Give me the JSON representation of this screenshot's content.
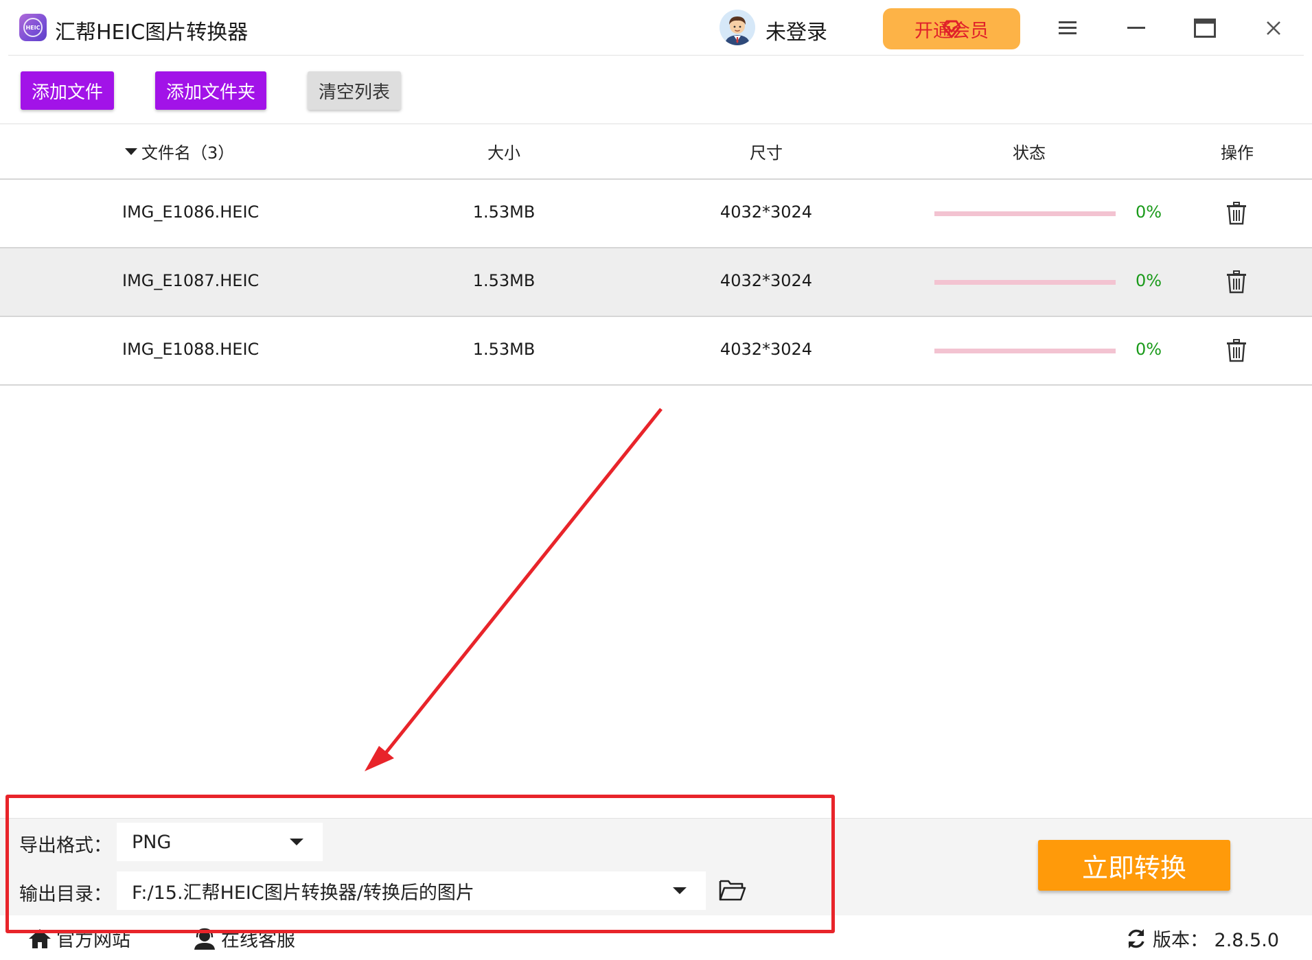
{
  "app": {
    "title": "汇帮HEIC图片转换器",
    "logo_text": "HEIC",
    "login_label": "未登录",
    "vip_label": "开通会员"
  },
  "toolbar": {
    "add_file": "添加文件",
    "add_folder": "添加文件夹",
    "clear_list": "清空列表"
  },
  "table": {
    "headers": {
      "filename": "文件名（3）",
      "size": "大小",
      "dimensions": "尺寸",
      "status": "状态",
      "action": "操作"
    },
    "rows": [
      {
        "name": "IMG_E1086.HEIC",
        "size": "1.53MB",
        "dimensions": "4032*3024",
        "progress": 0,
        "progress_text": "0%"
      },
      {
        "name": "IMG_E1087.HEIC",
        "size": "1.53MB",
        "dimensions": "4032*3024",
        "progress": 0,
        "progress_text": "0%"
      },
      {
        "name": "IMG_E1088.HEIC",
        "size": "1.53MB",
        "dimensions": "4032*3024",
        "progress": 0,
        "progress_text": "0%"
      }
    ]
  },
  "settings": {
    "format_label": "导出格式：",
    "format_value": "PNG",
    "output_label": "输出目录：",
    "output_value": "F:/15.汇帮HEIC图片转换器/转换后的图片"
  },
  "convert_button": "立即转换",
  "footer": {
    "website": "官方网站",
    "support": "在线客服",
    "version": "版本：  2.8.5.0"
  },
  "colors": {
    "primary_purple": "#a213e8",
    "convert_orange": "#ff9a0a",
    "vip_bg": "#fdb347",
    "vip_text": "#e0212a",
    "progress_track": "#f3c3d1",
    "status_green": "#1a9a1a",
    "annotation_red": "#e8242a"
  },
  "icons": [
    "app-logo-icon",
    "avatar-icon",
    "diamond-icon",
    "menu-icon",
    "minimize-icon",
    "maximize-icon",
    "close-icon",
    "sort-caret-icon",
    "trash-icon",
    "dropdown-caret-icon",
    "folder-open-icon",
    "home-icon",
    "headset-icon",
    "refresh-icon"
  ]
}
